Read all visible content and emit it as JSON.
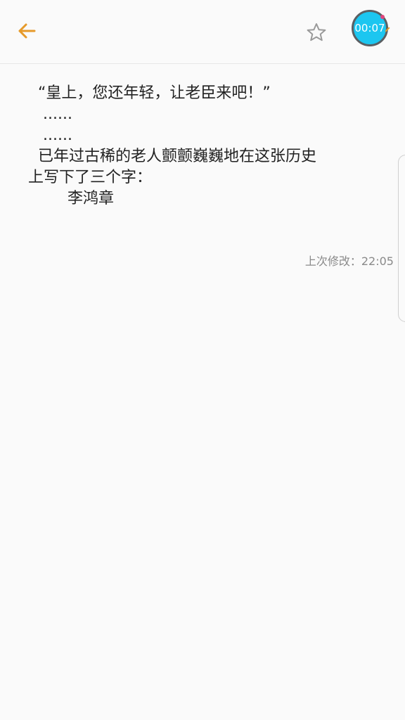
{
  "toolbar": {
    "back_icon": "arrow-left-icon",
    "favorite_icon": "star-outline-icon",
    "timer": "00:07",
    "colors": {
      "back": "#e69a2a",
      "star": "#9a9a9a",
      "timer_bg": "#1cc6f0",
      "timer_border": "#5a5f63"
    }
  },
  "note": {
    "lines": [
      "  “皇上，您还年轻，让老臣来吧！”",
      "   ......",
      "   ......",
      "  已年过古稀的老人颤颤巍巍地在这张历史",
      "上写下了三个字：",
      "        李鸿章"
    ],
    "last_modified": "上次修改：22:05"
  }
}
